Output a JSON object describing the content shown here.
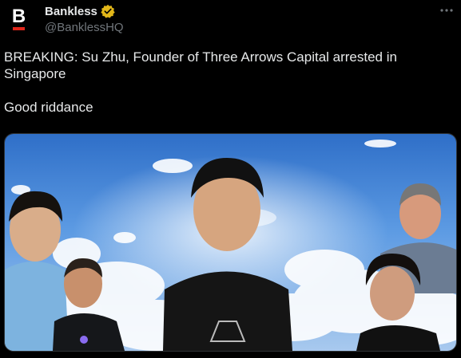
{
  "author": {
    "display_name": "Bankless",
    "handle": "@BanklessHQ",
    "avatar_letter": "B",
    "verified": true,
    "verified_color": "#e2b719"
  },
  "menu": {
    "icon": "more-horizontal-icon"
  },
  "tweet": {
    "line1": "BREAKING: Su Zhu, Founder of Three Arrows Capital arrested in Singapore",
    "line2": "Good riddance"
  },
  "media": {
    "type": "photo",
    "description_icon": "photo-collage"
  },
  "colors": {
    "background": "#000000",
    "text": "#e7e9ea",
    "secondary": "#71767b",
    "brand_red": "#e0261b"
  }
}
